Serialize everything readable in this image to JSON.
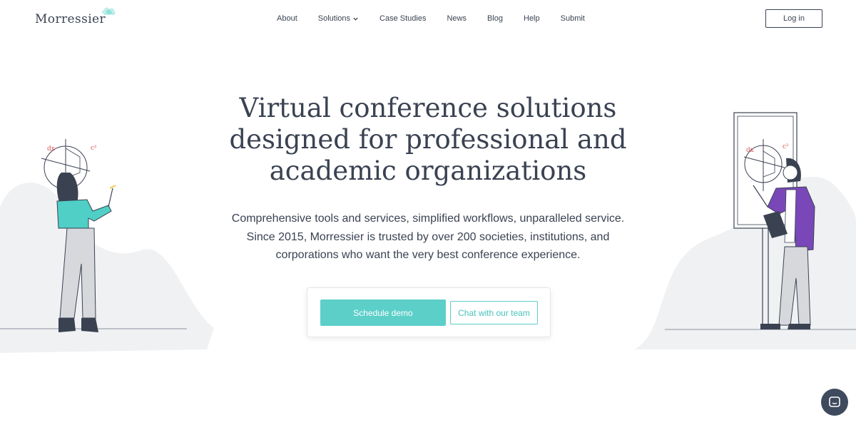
{
  "brand": {
    "name": "Morressier",
    "logo_icon": "cloud-logo-icon",
    "accent_color": "#5ccfc9",
    "text_color": "#3a4252"
  },
  "nav": {
    "items": [
      {
        "label": "About"
      },
      {
        "label": "Solutions",
        "has_dropdown": true
      },
      {
        "label": "Case Studies"
      },
      {
        "label": "News"
      },
      {
        "label": "Blog"
      },
      {
        "label": "Help"
      },
      {
        "label": "Submit"
      }
    ],
    "login_label": "Log in"
  },
  "hero": {
    "title_lines": [
      "Virtual conference solutions",
      "designed for professional and",
      "academic organizations"
    ],
    "subtitle_lines": [
      "Comprehensive tools and services, simplified workflows, unparalleled service.",
      "Since 2015, Morressier is trusted by over 200 societies, institutions, and",
      "corporations who want the very best conference experience."
    ]
  },
  "cta": {
    "demo_label": "Schedule demo",
    "chat_label": "Chat with our team"
  },
  "illustrations": {
    "left_labels": [
      "dx",
      "c²"
    ],
    "right_labels": [
      "dx",
      "c²"
    ]
  },
  "chat_widget": {
    "icon": "chat-bubble-icon"
  }
}
